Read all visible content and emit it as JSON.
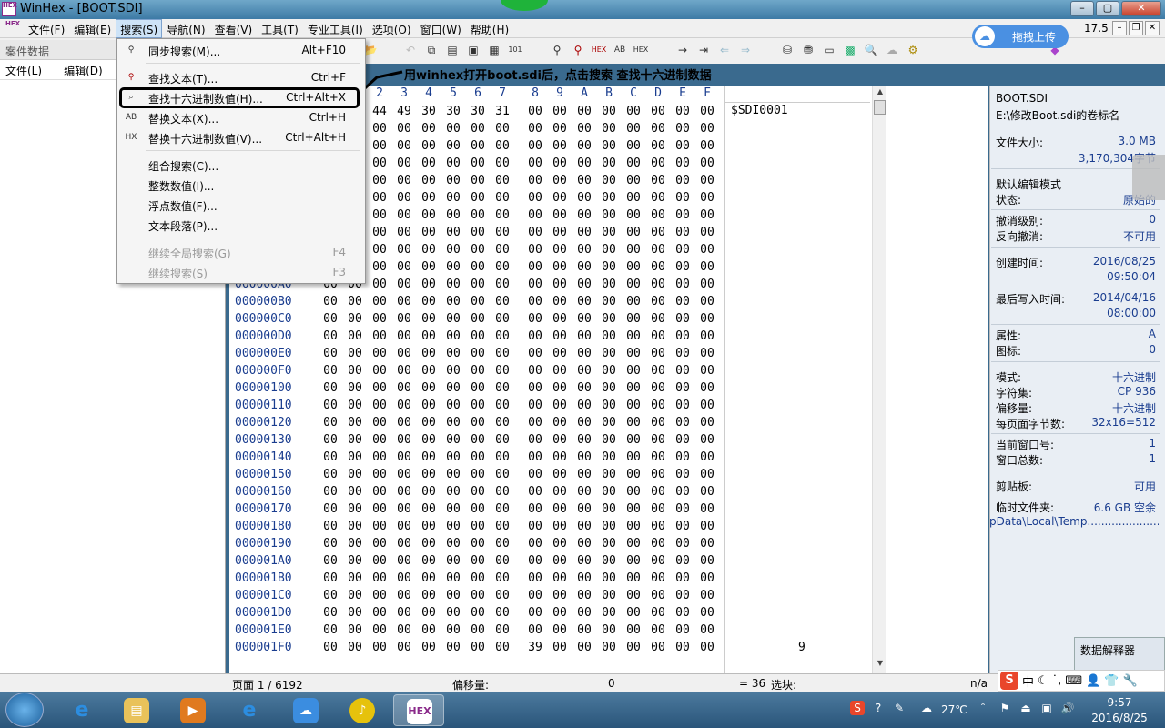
{
  "window": {
    "title": "WinHex - [BOOT.SDI]",
    "app_icon": "HEX"
  },
  "menubar": {
    "items": [
      "文件(F)",
      "编辑(E)",
      "搜索(S)",
      "导航(N)",
      "查看(V)",
      "工具(T)",
      "专业工具(I)",
      "选项(O)",
      "窗口(W)",
      "帮助(H)"
    ],
    "zoom": "17.5"
  },
  "upload_widget": {
    "label": "拖拽上传"
  },
  "left_panel": {
    "header": "案件数据",
    "menu_file": "文件(L)",
    "menu_edit": "编辑(D)"
  },
  "search_menu": {
    "items": [
      {
        "label": "同步搜索(M)...",
        "shortcut": "Alt+F10",
        "icon": "binoculars-icon",
        "disabled": false
      },
      {
        "label": "查找文本(T)...",
        "shortcut": "Ctrl+F",
        "icon": "binoculars-red-icon",
        "disabled": false
      },
      {
        "label": "查找十六进制数值(H)...",
        "shortcut": "Ctrl+Alt+X",
        "icon": "hex-search-icon",
        "disabled": false
      },
      {
        "label": "替换文本(X)...",
        "shortcut": "Ctrl+H",
        "icon": "replace-text-icon",
        "disabled": false
      },
      {
        "label": "替换十六进制数值(V)...",
        "shortcut": "Ctrl+Alt+H",
        "icon": "replace-hex-icon",
        "disabled": false
      },
      {
        "label": "组合搜索(C)...",
        "shortcut": "",
        "icon": "",
        "disabled": false
      },
      {
        "label": "整数数值(I)...",
        "shortcut": "",
        "icon": "",
        "disabled": false
      },
      {
        "label": "浮点数值(F)...",
        "shortcut": "",
        "icon": "",
        "disabled": false
      },
      {
        "label": "文本段落(P)...",
        "shortcut": "",
        "icon": "",
        "disabled": false
      },
      {
        "label": "继续全局搜索(G)",
        "shortcut": "F4",
        "icon": "",
        "disabled": true
      },
      {
        "label": "继续搜索(S)",
        "shortcut": "F3",
        "icon": "",
        "disabled": true
      }
    ]
  },
  "annotation": "用winhex打开boot.sdi后，点击搜索 查找十六进制数据",
  "hex_view": {
    "column_headers": [
      "2",
      "3",
      "4",
      "5",
      "6",
      "7",
      "8",
      "9",
      "A",
      "B",
      "C",
      "D",
      "E",
      "F"
    ],
    "offsets": [
      "000000A0",
      "000000B0",
      "000000C0",
      "000000D0",
      "000000E0",
      "000000F0",
      "00000100",
      "00000110",
      "00000120",
      "00000130",
      "00000140",
      "00000150",
      "00000160",
      "00000170",
      "00000180",
      "00000190",
      "000001A0",
      "000001B0",
      "000001C0",
      "000001D0",
      "000001E0",
      "000001F0"
    ],
    "first_row_bytes": [
      "44",
      "49",
      "30",
      "30",
      "30",
      "31",
      "00",
      "00",
      "00",
      "00",
      "00",
      "00",
      "00",
      "00"
    ],
    "last_row_bytes": [
      "00",
      "00",
      "00",
      "00",
      "00",
      "00",
      "00",
      "00",
      "39",
      "00",
      "00",
      "00",
      "00",
      "00",
      "00",
      "00"
    ],
    "zero_byte": "00",
    "text_first_row": "$SDI0001",
    "text_last_row": "9"
  },
  "info_panel": {
    "filename": "BOOT.SDI",
    "path": "E:\\修改Boot.sdi的卷标名",
    "file_size_label": "文件大小:",
    "file_size": "3.0 MB",
    "file_size_bytes": "3,170,304字节",
    "edit_mode_label": "默认编辑模式",
    "state_label": "状态:",
    "state": "原始的",
    "undo_level_label": "撤消级别:",
    "undo_level": "0",
    "reverse_undo_label": "反向撤消:",
    "reverse_undo": "不可用",
    "created_label": "创建时间:",
    "created_date": "2016/08/25",
    "created_time": "09:50:04",
    "modified_label": "最后写入时间:",
    "modified_date": "2014/04/16",
    "modified_time": "08:00:00",
    "attr_label": "属性:",
    "attr": "A",
    "icon_label": "图标:",
    "icon": "0",
    "mode_label": "模式:",
    "mode": "十六进制",
    "charset_label": "字符集:",
    "charset": "CP 936",
    "offset_label": "偏移量:",
    "offset": "十六进制",
    "bytes_per_page_label": "每页面字节数:",
    "bytes_per_page": "32x16=512",
    "current_window_label": "当前窗口号:",
    "current_window": "1",
    "total_windows_label": "窗口总数:",
    "total_windows": "1",
    "clipboard_label": "剪贴板:",
    "clipboard": "可用",
    "temp_label": "临时文件夹:",
    "temp_free": "6.6 GB 空余",
    "temp_path": "pData\\Local\\Temp........................",
    "interpreter": "数据解释器"
  },
  "status_bar": {
    "page": "页面 1 / 6192",
    "offset_label": "偏移量:",
    "offset_value": "0",
    "equals": "= 36",
    "selection_label": "选块:",
    "na": "n/a"
  },
  "taskbar": {
    "temperature": "27℃",
    "time": "9:57",
    "date": "2016/8/25",
    "active_app_label": "HEX"
  },
  "ime": {
    "lang": "中"
  }
}
